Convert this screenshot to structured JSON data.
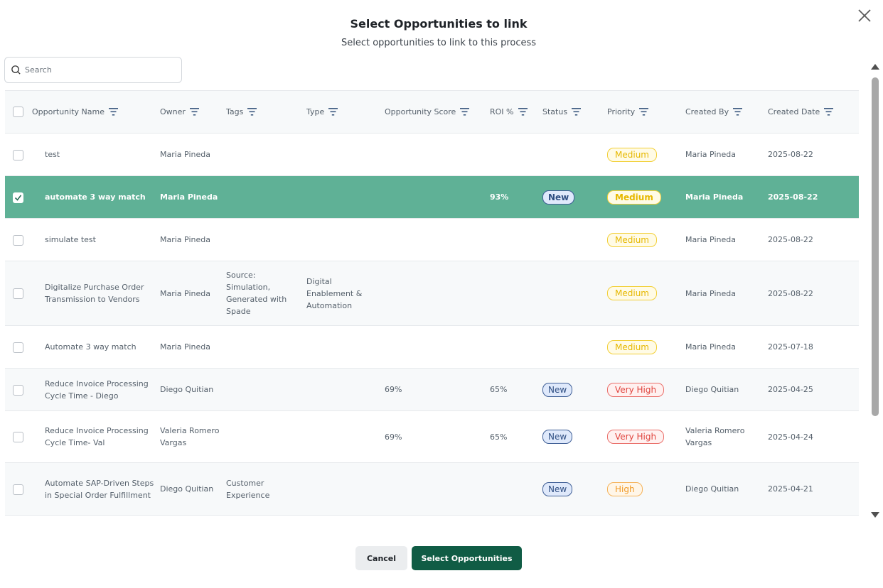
{
  "dialog": {
    "title": "Select Opportunities to link",
    "subtitle": "Select opportunities to link to this process"
  },
  "search": {
    "placeholder": "Search",
    "value": ""
  },
  "columns": [
    "Opportunity Name",
    "Owner",
    "Tags",
    "Type",
    "Opportunity Score",
    "ROI %",
    "Status",
    "Priority",
    "Created By",
    "Created Date"
  ],
  "rows": [
    {
      "name": "test",
      "owner": "Maria Pineda",
      "tags": "",
      "type": "",
      "score": "",
      "roi": "",
      "status": "",
      "priority": "Medium",
      "created_by": "Maria Pineda",
      "created_date": "2025-08-22",
      "selected": false
    },
    {
      "name": "automate 3 way match",
      "owner": "Maria Pineda",
      "tags": "",
      "type": "",
      "score": "",
      "roi": "93%",
      "status": "New",
      "priority": "Medium",
      "created_by": "Maria Pineda",
      "created_date": "2025-08-22",
      "selected": true
    },
    {
      "name": "simulate test",
      "owner": "Maria Pineda",
      "tags": "",
      "type": "",
      "score": "",
      "roi": "",
      "status": "",
      "priority": "Medium",
      "created_by": "Maria Pineda",
      "created_date": "2025-08-22",
      "selected": false
    },
    {
      "name": "Digitalize Purchase Order Transmission to Vendors",
      "owner": "Maria Pineda",
      "tags": "Source: Simulation, Generated with Spade",
      "type": "Digital Enablement & Automation",
      "score": "",
      "roi": "",
      "status": "",
      "priority": "Medium",
      "created_by": "Maria Pineda",
      "created_date": "2025-08-22",
      "selected": false
    },
    {
      "name": "Automate 3 way match",
      "owner": "Maria Pineda",
      "tags": "",
      "type": "",
      "score": "",
      "roi": "",
      "status": "",
      "priority": "Medium",
      "created_by": "Maria Pineda",
      "created_date": "2025-07-18",
      "selected": false
    },
    {
      "name": "Reduce Invoice Processing Cycle Time - Diego",
      "owner": "Diego Quitian",
      "tags": "",
      "type": "",
      "score": "69%",
      "roi": "65%",
      "status": "New",
      "priority": "Very High",
      "created_by": "Diego Quitian",
      "created_date": "2025-04-25",
      "selected": false
    },
    {
      "name": "Reduce Invoice Processing Cycle Time- Val",
      "owner": "Valeria Romero Vargas",
      "tags": "",
      "type": "",
      "score": "69%",
      "roi": "65%",
      "status": "New",
      "priority": "Very High",
      "created_by": "Valeria Romero Vargas",
      "created_date": "2025-04-24",
      "selected": false
    },
    {
      "name": "Automate SAP-Driven Steps in Special Order Fulfillment",
      "owner": "Diego Quitian",
      "tags": "Customer Experience",
      "type": "",
      "score": "",
      "roi": "",
      "status": "New",
      "priority": "High",
      "created_by": "Diego Quitian",
      "created_date": "2025-04-21",
      "selected": false
    }
  ],
  "footer": {
    "cancel_label": "Cancel",
    "submit_label": "Select Opportunities"
  },
  "colors": {
    "selected_row": "#5fb196",
    "primary_button": "#105c45",
    "medium": "#e6b800",
    "very_high": "#e0443e",
    "high": "#f09a26",
    "new": "#2f4f83"
  },
  "icons": {
    "close": "close-icon",
    "search": "search-icon",
    "filter": "filter-icon",
    "check": "check-icon"
  }
}
